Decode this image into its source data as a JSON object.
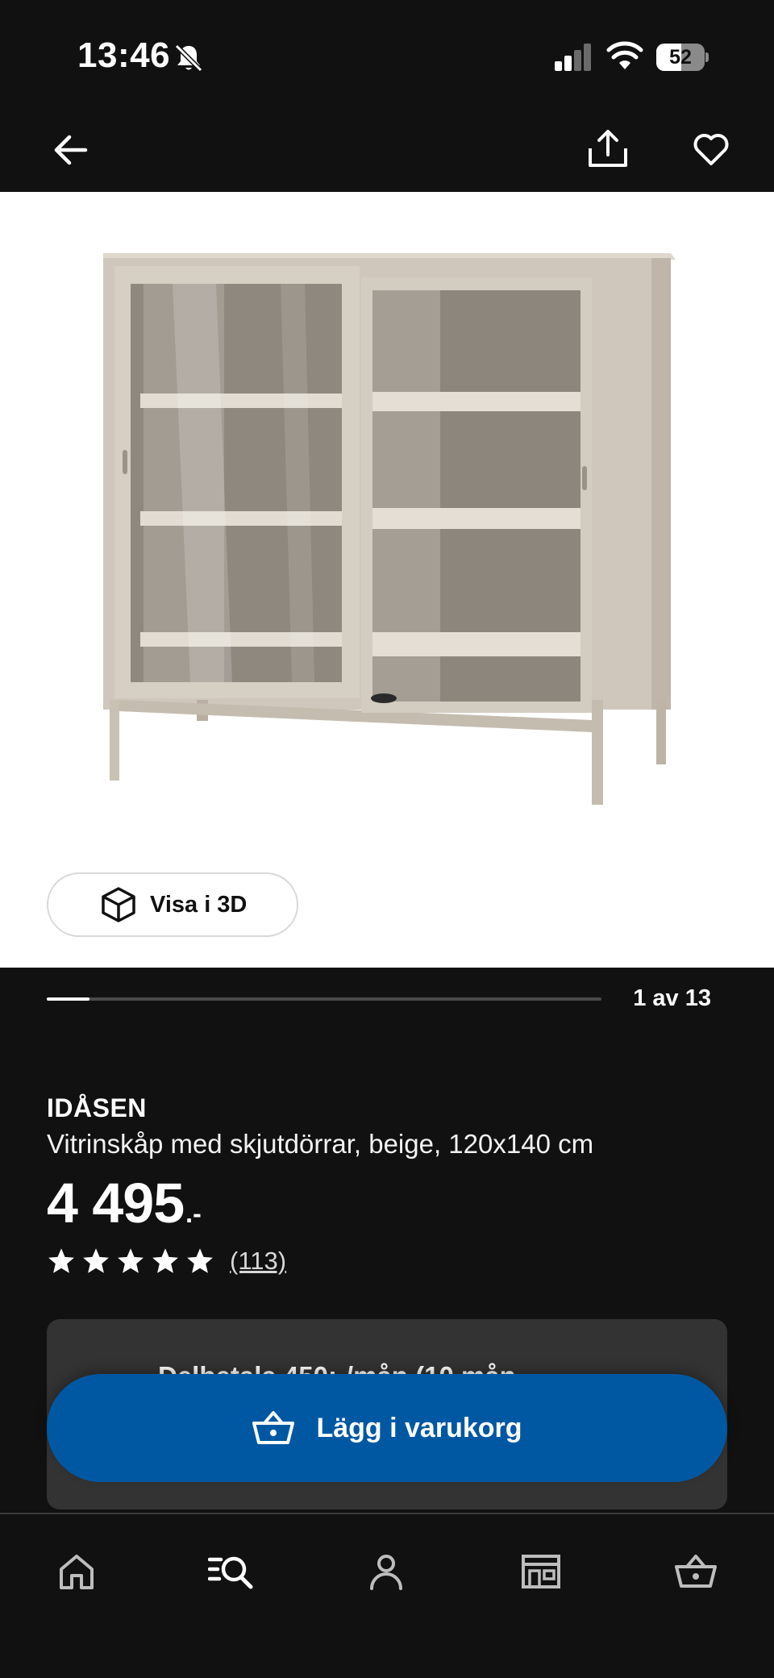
{
  "status_bar": {
    "time": "13:46",
    "battery_level": "52",
    "battery_fraction": 0.52,
    "icons": [
      "bell-muted-icon",
      "signal-icon",
      "wifi-icon",
      "battery-icon"
    ]
  },
  "top_nav": {
    "icons": [
      "arrow-left-icon",
      "share-icon",
      "heart-icon"
    ]
  },
  "media": {
    "view_3d_label": "Visa i 3D",
    "image_counter": "1 av 13",
    "progress_fraction": 0.077
  },
  "product": {
    "name": "IDÅSEN",
    "description": "Vitrinskåp med skjutdörrar, beige, 120x140 cm",
    "price": "4 495",
    "price_suffix": ".-",
    "rating_stars": 5,
    "review_count": "(113)"
  },
  "installment": {
    "text": "Delbetala 450:-/mån (10 mån"
  },
  "cta": {
    "add_to_cart_label": "Lägg i varukorg"
  },
  "tab_bar": {
    "icons": [
      "home-icon",
      "search-list-icon",
      "profile-icon",
      "store-icon",
      "basket-icon"
    ]
  },
  "colors": {
    "background": "#111111",
    "accent_blue": "#0058a3",
    "card": "#333333",
    "beige_product": "#cfc7bb"
  }
}
